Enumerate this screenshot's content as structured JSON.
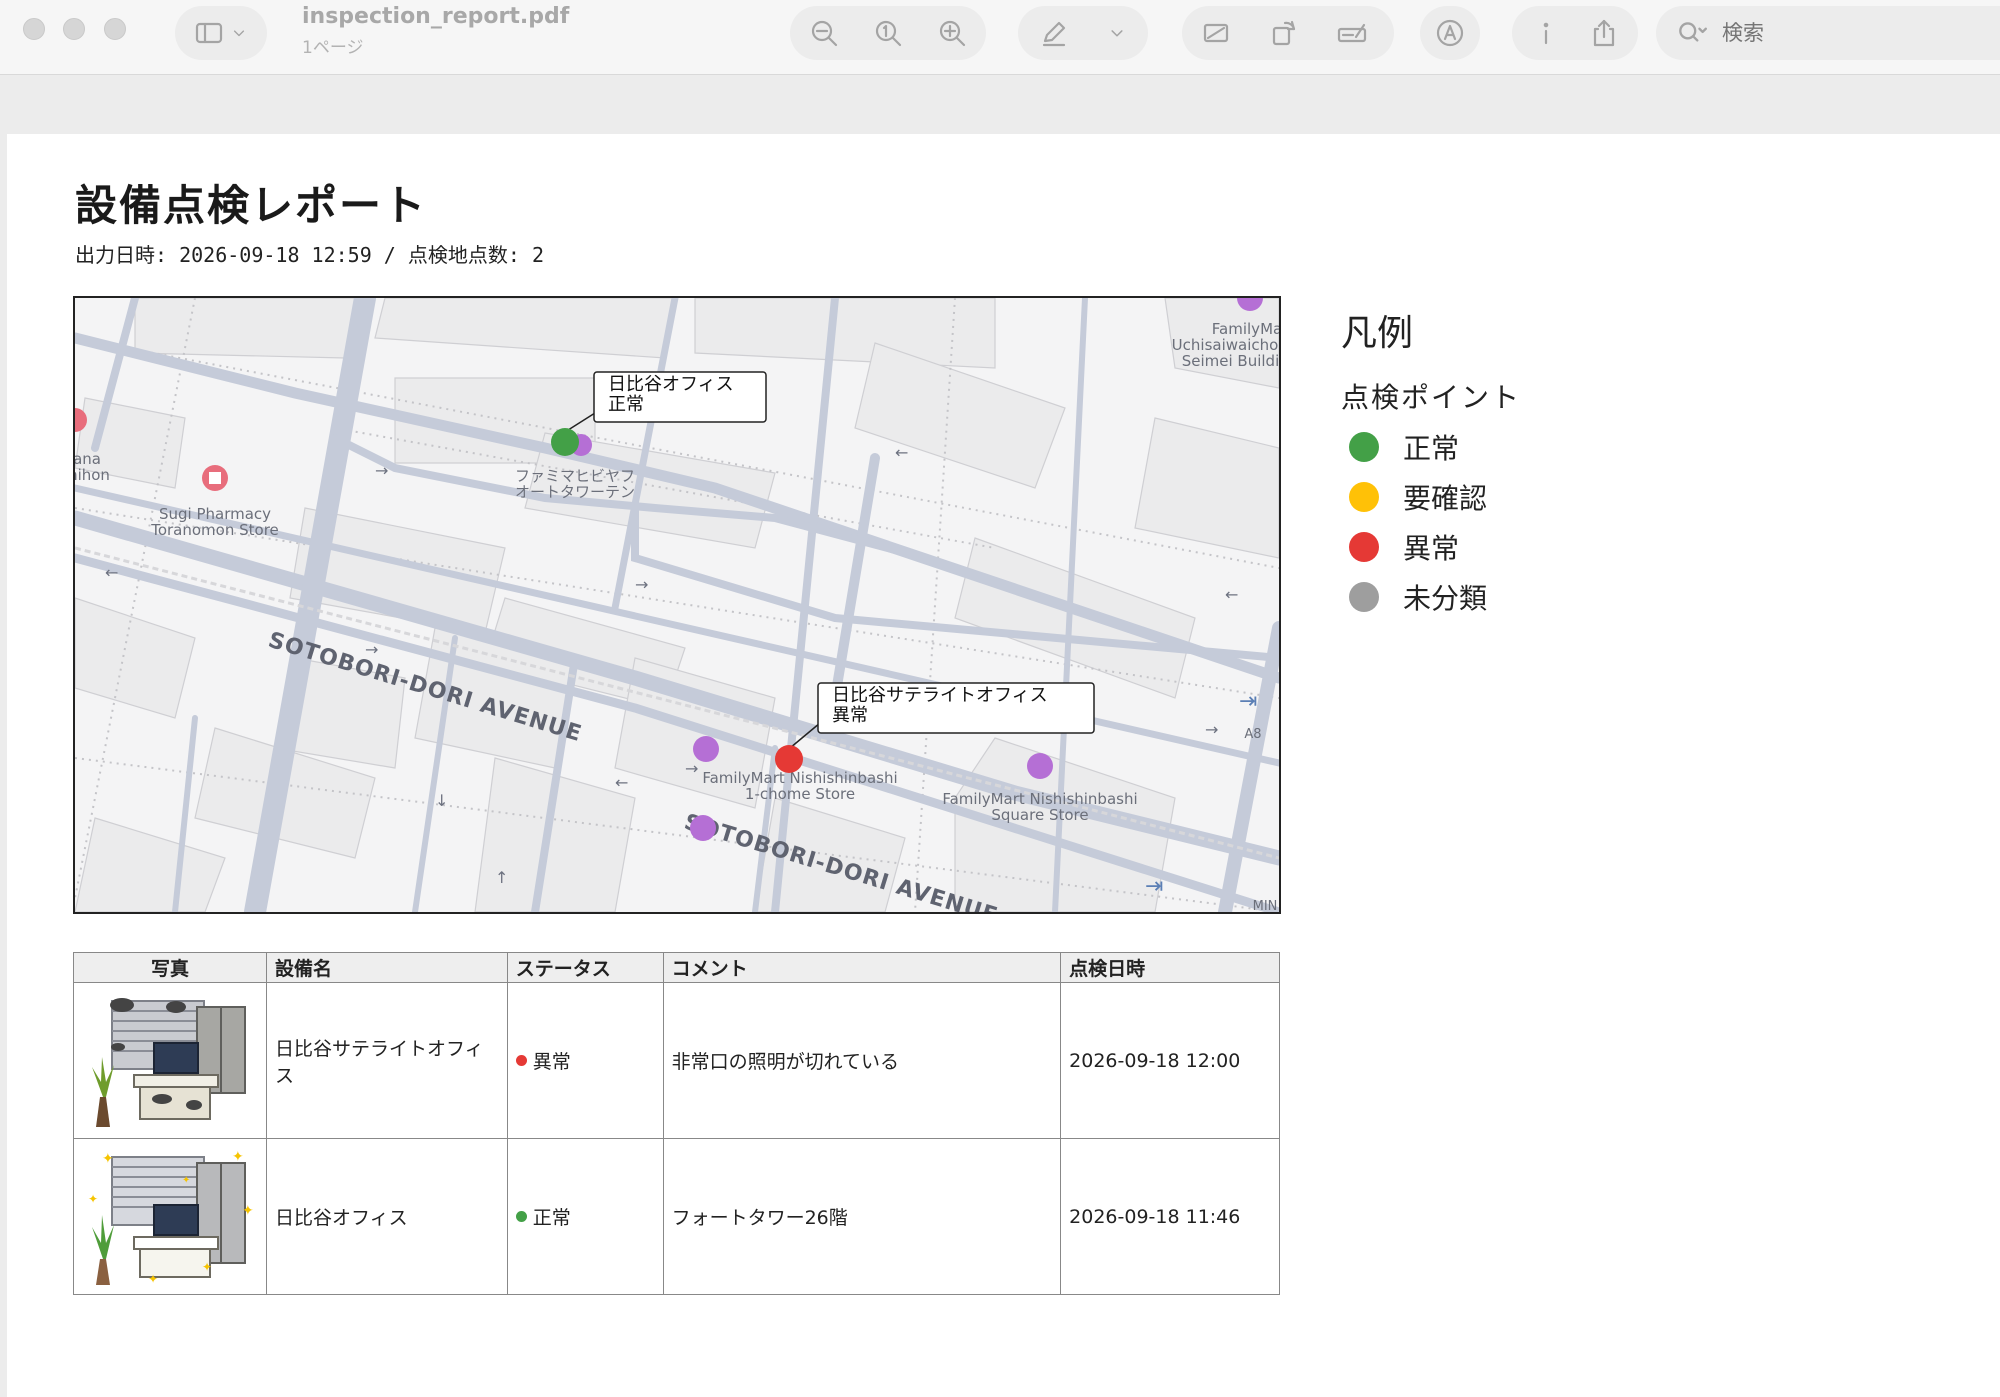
{
  "window": {
    "title": "inspection_report.pdf",
    "subtitle": "1ページ",
    "search_placeholder": "検索"
  },
  "report": {
    "title": "設備点検レポート",
    "meta": "出力日時: 2026-09-18 12:59 / 点検地点数: 2"
  },
  "map": {
    "streets": [
      "SOTOBORI-DORI AVENUE",
      "SOTOBORI-DORI AVENUE"
    ],
    "poi_labels": [
      "ファミマヒビヤフ",
      "オートタワーテン",
      "Sugi Pharmacy",
      "Toranomon Store",
      "FamilyMart Nishishinbashi",
      "1-chome Store",
      "FamilyMart Nishishinbashi",
      "Square Store",
      "FamilyMa",
      "Uchisaiwaicho",
      "Seimei Building",
      "ana",
      "hihon",
      "A8",
      "MIN"
    ],
    "markers": [
      {
        "name": "日比谷オフィス",
        "status": "正常",
        "color": "#43a047"
      },
      {
        "name": "日比谷サテライトオフィス",
        "status": "異常",
        "color": "#e53935"
      }
    ]
  },
  "legend": {
    "title": "凡例",
    "subtitle": "点検ポイント",
    "items": [
      {
        "label": "正常",
        "color": "#43a047"
      },
      {
        "label": "要確認",
        "color": "#ffc107"
      },
      {
        "label": "異常",
        "color": "#e53935"
      },
      {
        "label": "未分類",
        "color": "#9e9e9e"
      }
    ]
  },
  "table": {
    "headers": [
      "写真",
      "設備名",
      "ステータス",
      "コメント",
      "点検日時"
    ],
    "rows": [
      {
        "name": "日比谷サテライトオフィス",
        "status": "異常",
        "status_color": "#e53935",
        "comment": "非常口の照明が切れている",
        "datetime": "2026-09-18 12:00"
      },
      {
        "name": "日比谷オフィス",
        "status": "正常",
        "status_color": "#43a047",
        "comment": "フォートタワー26階",
        "datetime": "2026-09-18 11:46"
      }
    ]
  }
}
